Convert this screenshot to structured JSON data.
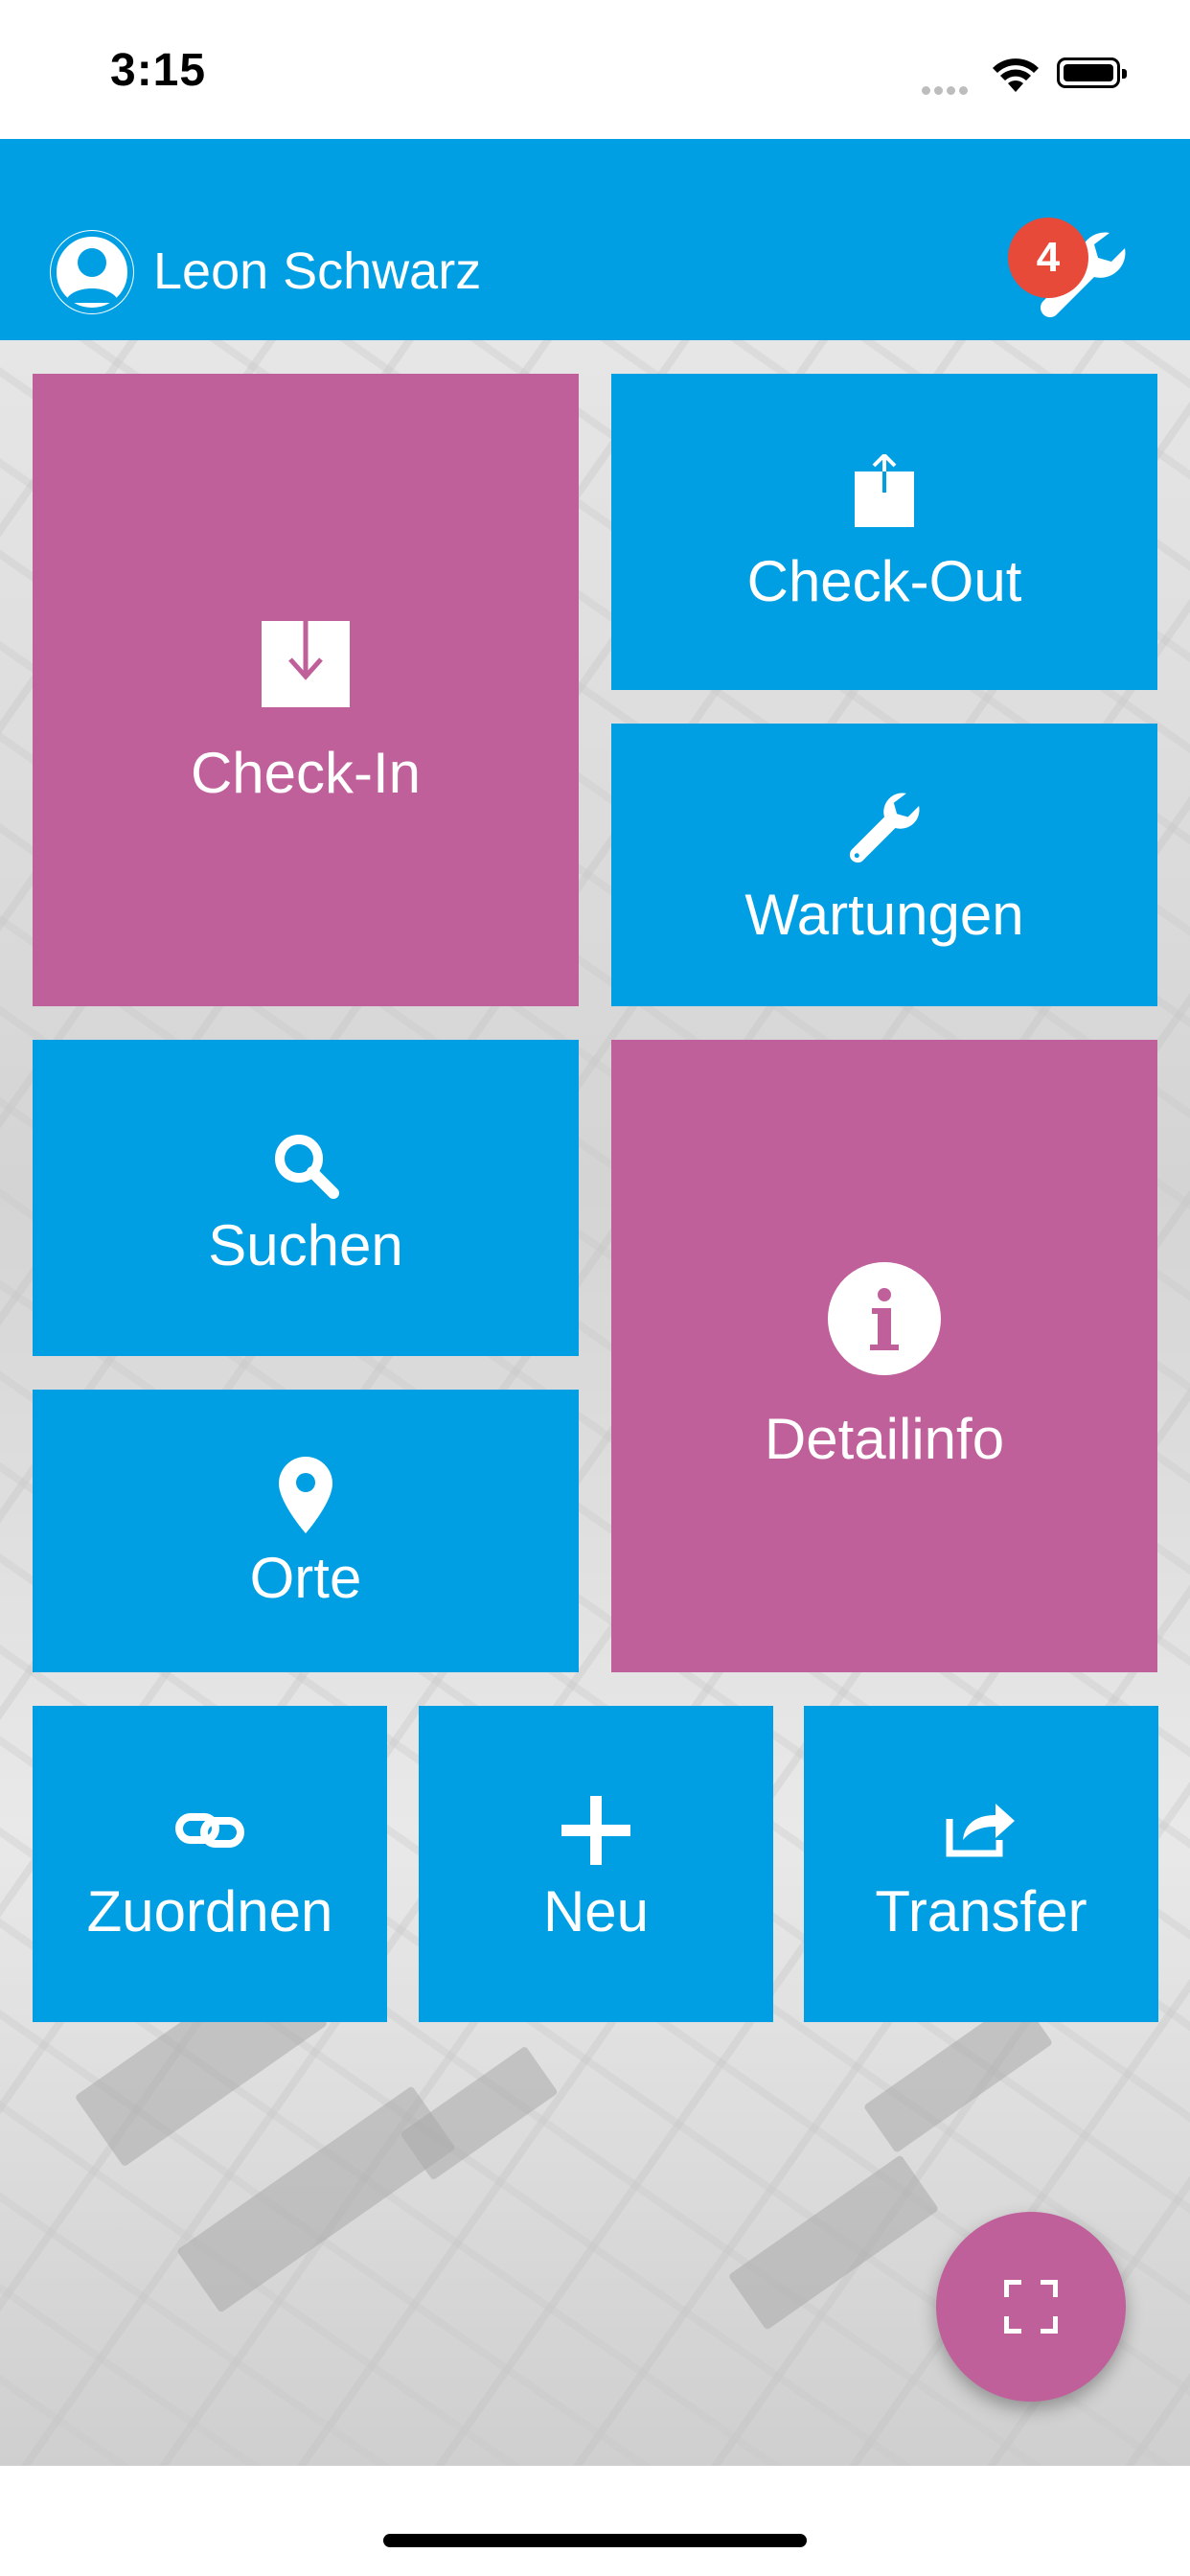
{
  "status_bar": {
    "time": "3:15"
  },
  "app_bar": {
    "user_name": "Leon Schwarz",
    "maintenance_badge_count": "4"
  },
  "tiles": {
    "check_in": "Check-In",
    "check_out": "Check-Out",
    "wartungen": "Wartungen",
    "suchen": "Suchen",
    "detailinfo": "Detailinfo",
    "orte": "Orte",
    "zuordnen": "Zuordnen",
    "neu": "Neu",
    "transfer": "Transfer"
  },
  "colors": {
    "blue": "#009fe3",
    "pink": "#c0609b",
    "badge": "#e84a3a"
  },
  "icons": {
    "check_in": "download-box-icon",
    "check_out": "upload-box-icon",
    "wartungen": "wrench-icon",
    "suchen": "search-icon",
    "detailinfo": "info-icon",
    "orte": "map-pin-icon",
    "zuordnen": "link-icon",
    "neu": "plus-icon",
    "transfer": "share-icon",
    "fab": "scan-frame-icon"
  }
}
